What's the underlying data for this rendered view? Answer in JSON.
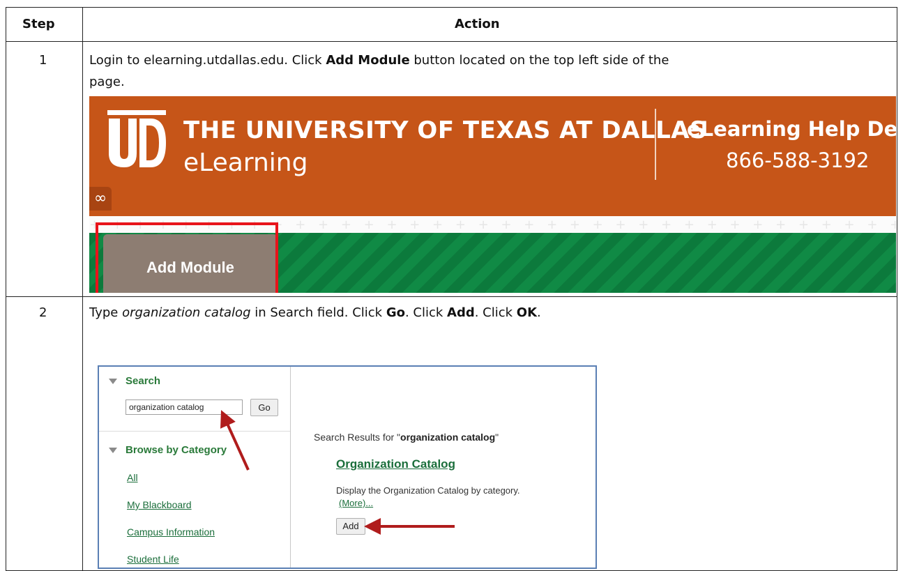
{
  "table": {
    "header_step": "Step",
    "header_action": "Action",
    "rows": [
      {
        "step": "1",
        "instruction": {
          "line1_pre": "Login to elearning.utdallas.edu. Click ",
          "line1_bold": "Add Module",
          "line1_post": " button located on the top left side of the",
          "line2": "page."
        }
      },
      {
        "step": "2",
        "instruction": {
          "pre": "Type ",
          "italic": "organization catalog",
          "mid1": " in Search field. Click ",
          "bold1": "Go",
          "mid2": ". Click ",
          "bold2": "Add",
          "mid3": ". Click ",
          "bold3": "OK",
          "end": "."
        }
      }
    ]
  },
  "screenshot1": {
    "university_name": "THE UNIVERSITY OF TEXAS AT DALLAS",
    "elearning_label": "eLearning",
    "help_desk_title": "eLearning Help Des",
    "help_desk_phone": "866-588-3192",
    "logo_text": "UTD",
    "link_icon": "link-icon",
    "add_module_label": "Add Module",
    "colors": {
      "banner": "#c65518",
      "green_bar": "#0c7a3c",
      "tab": "#8d7d72",
      "highlight": "#e8141b"
    }
  },
  "screenshot2": {
    "search_label": "Search",
    "search_value": "organization catalog",
    "go_label": "Go",
    "browse_label": "Browse by Category",
    "categories": [
      "All",
      "My Blackboard",
      "Campus Information",
      "Student Life"
    ],
    "results_prefix": "Search Results for \"",
    "results_query": "organization catalog",
    "results_suffix": "\"",
    "module_title": "Organization Catalog",
    "module_description": "Display the Organization Catalog by category.",
    "more_link": "(More)...",
    "add_label": "Add",
    "arrow_color": "#b01c1c"
  }
}
